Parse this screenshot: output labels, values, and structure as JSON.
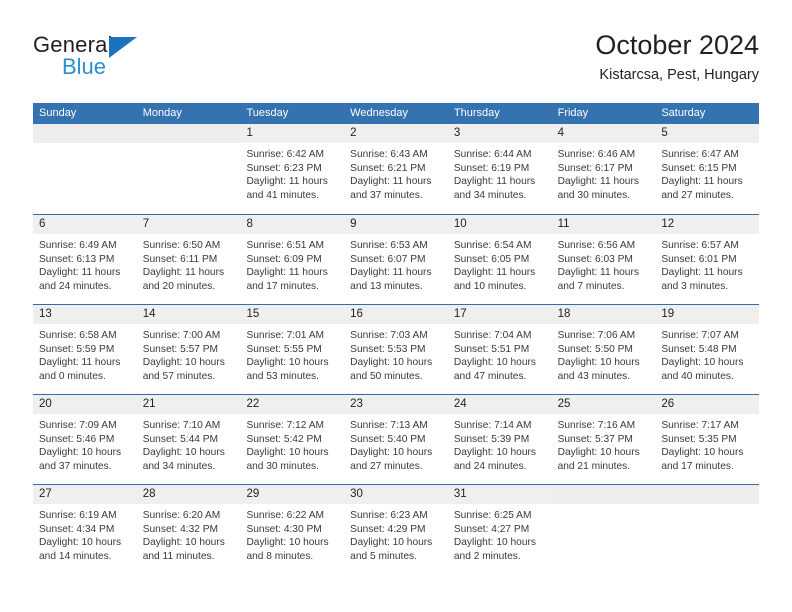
{
  "brand": {
    "name_top": "General",
    "name_bottom": "Blue",
    "triangle_icon": "brand-triangle-icon",
    "color_dark": "#231f20",
    "color_blue": "#2a8fd4",
    "color_triangle": "#1b72bd"
  },
  "header": {
    "title": "October 2024",
    "subtitle": "Kistarcsa, Pest, Hungary"
  },
  "theme": {
    "header_blue": "#3572b0",
    "row_separator_blue": "#2f6fae",
    "daynum_band": "#efefef",
    "empty_band": "#ededed"
  },
  "weekdays": [
    "Sunday",
    "Monday",
    "Tuesday",
    "Wednesday",
    "Thursday",
    "Friday",
    "Saturday"
  ],
  "weeks": [
    [
      {
        "day": "",
        "lines": []
      },
      {
        "day": "",
        "lines": []
      },
      {
        "day": "1",
        "lines": [
          "Sunrise: 6:42 AM",
          "Sunset: 6:23 PM",
          "Daylight: 11 hours",
          "and 41 minutes."
        ]
      },
      {
        "day": "2",
        "lines": [
          "Sunrise: 6:43 AM",
          "Sunset: 6:21 PM",
          "Daylight: 11 hours",
          "and 37 minutes."
        ]
      },
      {
        "day": "3",
        "lines": [
          "Sunrise: 6:44 AM",
          "Sunset: 6:19 PM",
          "Daylight: 11 hours",
          "and 34 minutes."
        ]
      },
      {
        "day": "4",
        "lines": [
          "Sunrise: 6:46 AM",
          "Sunset: 6:17 PM",
          "Daylight: 11 hours",
          "and 30 minutes."
        ]
      },
      {
        "day": "5",
        "lines": [
          "Sunrise: 6:47 AM",
          "Sunset: 6:15 PM",
          "Daylight: 11 hours",
          "and 27 minutes."
        ]
      }
    ],
    [
      {
        "day": "6",
        "lines": [
          "Sunrise: 6:49 AM",
          "Sunset: 6:13 PM",
          "Daylight: 11 hours",
          "and 24 minutes."
        ]
      },
      {
        "day": "7",
        "lines": [
          "Sunrise: 6:50 AM",
          "Sunset: 6:11 PM",
          "Daylight: 11 hours",
          "and 20 minutes."
        ]
      },
      {
        "day": "8",
        "lines": [
          "Sunrise: 6:51 AM",
          "Sunset: 6:09 PM",
          "Daylight: 11 hours",
          "and 17 minutes."
        ]
      },
      {
        "day": "9",
        "lines": [
          "Sunrise: 6:53 AM",
          "Sunset: 6:07 PM",
          "Daylight: 11 hours",
          "and 13 minutes."
        ]
      },
      {
        "day": "10",
        "lines": [
          "Sunrise: 6:54 AM",
          "Sunset: 6:05 PM",
          "Daylight: 11 hours",
          "and 10 minutes."
        ]
      },
      {
        "day": "11",
        "lines": [
          "Sunrise: 6:56 AM",
          "Sunset: 6:03 PM",
          "Daylight: 11 hours",
          "and 7 minutes."
        ]
      },
      {
        "day": "12",
        "lines": [
          "Sunrise: 6:57 AM",
          "Sunset: 6:01 PM",
          "Daylight: 11 hours",
          "and 3 minutes."
        ]
      }
    ],
    [
      {
        "day": "13",
        "lines": [
          "Sunrise: 6:58 AM",
          "Sunset: 5:59 PM",
          "Daylight: 11 hours",
          "and 0 minutes."
        ]
      },
      {
        "day": "14",
        "lines": [
          "Sunrise: 7:00 AM",
          "Sunset: 5:57 PM",
          "Daylight: 10 hours",
          "and 57 minutes."
        ]
      },
      {
        "day": "15",
        "lines": [
          "Sunrise: 7:01 AM",
          "Sunset: 5:55 PM",
          "Daylight: 10 hours",
          "and 53 minutes."
        ]
      },
      {
        "day": "16",
        "lines": [
          "Sunrise: 7:03 AM",
          "Sunset: 5:53 PM",
          "Daylight: 10 hours",
          "and 50 minutes."
        ]
      },
      {
        "day": "17",
        "lines": [
          "Sunrise: 7:04 AM",
          "Sunset: 5:51 PM",
          "Daylight: 10 hours",
          "and 47 minutes."
        ]
      },
      {
        "day": "18",
        "lines": [
          "Sunrise: 7:06 AM",
          "Sunset: 5:50 PM",
          "Daylight: 10 hours",
          "and 43 minutes."
        ]
      },
      {
        "day": "19",
        "lines": [
          "Sunrise: 7:07 AM",
          "Sunset: 5:48 PM",
          "Daylight: 10 hours",
          "and 40 minutes."
        ]
      }
    ],
    [
      {
        "day": "20",
        "lines": [
          "Sunrise: 7:09 AM",
          "Sunset: 5:46 PM",
          "Daylight: 10 hours",
          "and 37 minutes."
        ]
      },
      {
        "day": "21",
        "lines": [
          "Sunrise: 7:10 AM",
          "Sunset: 5:44 PM",
          "Daylight: 10 hours",
          "and 34 minutes."
        ]
      },
      {
        "day": "22",
        "lines": [
          "Sunrise: 7:12 AM",
          "Sunset: 5:42 PM",
          "Daylight: 10 hours",
          "and 30 minutes."
        ]
      },
      {
        "day": "23",
        "lines": [
          "Sunrise: 7:13 AM",
          "Sunset: 5:40 PM",
          "Daylight: 10 hours",
          "and 27 minutes."
        ]
      },
      {
        "day": "24",
        "lines": [
          "Sunrise: 7:14 AM",
          "Sunset: 5:39 PM",
          "Daylight: 10 hours",
          "and 24 minutes."
        ]
      },
      {
        "day": "25",
        "lines": [
          "Sunrise: 7:16 AM",
          "Sunset: 5:37 PM",
          "Daylight: 10 hours",
          "and 21 minutes."
        ]
      },
      {
        "day": "26",
        "lines": [
          "Sunrise: 7:17 AM",
          "Sunset: 5:35 PM",
          "Daylight: 10 hours",
          "and 17 minutes."
        ]
      }
    ],
    [
      {
        "day": "27",
        "lines": [
          "Sunrise: 6:19 AM",
          "Sunset: 4:34 PM",
          "Daylight: 10 hours",
          "and 14 minutes."
        ]
      },
      {
        "day": "28",
        "lines": [
          "Sunrise: 6:20 AM",
          "Sunset: 4:32 PM",
          "Daylight: 10 hours",
          "and 11 minutes."
        ]
      },
      {
        "day": "29",
        "lines": [
          "Sunrise: 6:22 AM",
          "Sunset: 4:30 PM",
          "Daylight: 10 hours",
          "and 8 minutes."
        ]
      },
      {
        "day": "30",
        "lines": [
          "Sunrise: 6:23 AM",
          "Sunset: 4:29 PM",
          "Daylight: 10 hours",
          "and 5 minutes."
        ]
      },
      {
        "day": "31",
        "lines": [
          "Sunrise: 6:25 AM",
          "Sunset: 4:27 PM",
          "Daylight: 10 hours",
          "and 2 minutes."
        ]
      },
      {
        "day": "",
        "lines": []
      },
      {
        "day": "",
        "lines": []
      }
    ]
  ]
}
